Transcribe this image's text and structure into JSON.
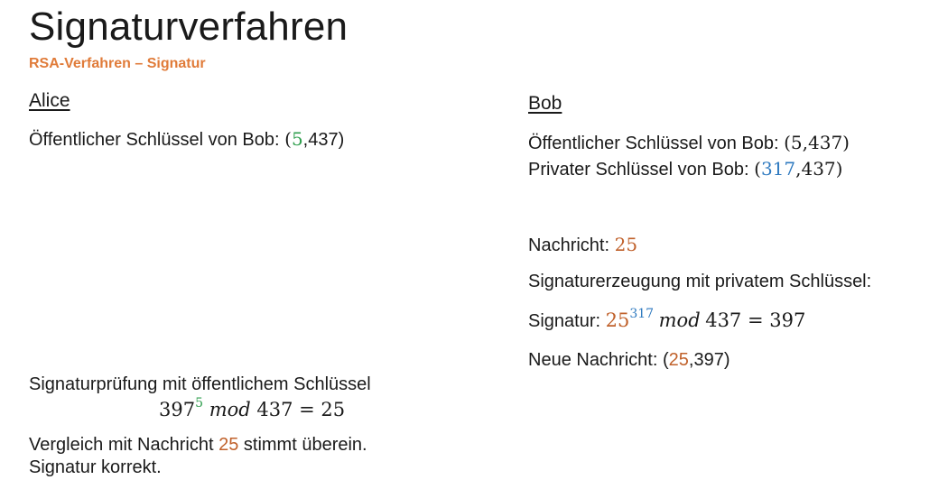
{
  "title": "Signaturverfahren",
  "subtitle": "RSA-Verfahren –  Signatur",
  "colors": {
    "subtitle": "#e07b39",
    "e_value": "#2e9e4d",
    "d_value": "#2f7ac0",
    "message_value": "#c0612b"
  },
  "alice": {
    "heading": "Alice",
    "pubkey_label": "Öffentlicher Schlüssel von Bob: ",
    "pubkey_open": "(",
    "pubkey_e": "5",
    "pubkey_rest": ",437)",
    "verify_label": "Signaturprüfung mit öffentlichem Schlüssel",
    "verify_base": "397",
    "verify_exp": "5",
    "verify_mod": "mod",
    "verify_rest": "437 = 25",
    "compare_prefix": "Vergleich mit Nachricht ",
    "compare_value": "25",
    "compare_suffix": " stimmt überein.",
    "result": "Signatur korrekt."
  },
  "bob": {
    "heading": "Bob",
    "pubkey_label": "Öffentlicher Schlüssel von Bob: ",
    "pubkey_value": "(5,437)",
    "privkey_label": "Privater Schlüssel von Bob: ",
    "privkey_open": "(",
    "privkey_d": "317",
    "privkey_rest": ",437)",
    "message_label": "Nachricht: ",
    "message_value": "25",
    "sig_gen_label": "Signaturerzeugung mit privatem Schlüssel:",
    "sig_label": "Signatur: ",
    "sig_base": "25",
    "sig_exp": "317",
    "sig_mod": "mod",
    "sig_rest": "437 = 397",
    "new_msg_label": "Neue Nachricht:  ",
    "new_msg_open": "(",
    "new_msg_m": "25",
    "new_msg_rest": ",397)"
  }
}
